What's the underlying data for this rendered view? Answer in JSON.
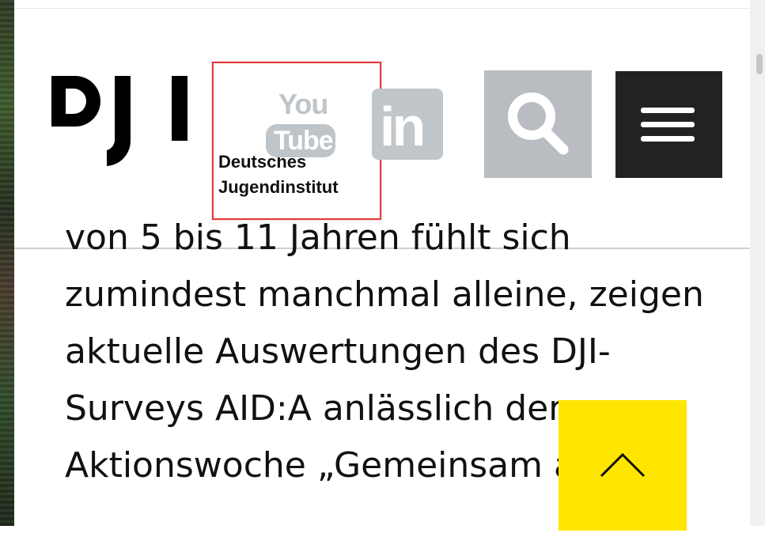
{
  "header": {
    "logo_alt": "DJI",
    "logo_text_line1": "Deutsches",
    "logo_text_line2": "Jugendinstitut",
    "youtube": {
      "top": "You",
      "bottom": "Tube"
    },
    "linkedin": "in",
    "icons": {
      "search": "search-icon",
      "menu": "hamburger-menu-icon",
      "youtube": "youtube-icon",
      "linkedin": "linkedin-icon"
    },
    "colors": {
      "highlight": "#e23a3a",
      "icon_gray": "#bfc4c8",
      "menu_bg": "#222222",
      "to_top_bg": "#ffe600"
    }
  },
  "article": {
    "lines": [
      "von 5 bis 11 Jahren fühlt sich",
      "zumindest manchmal alleine, zeigen",
      "aktuelle Auswertungen des DJI-",
      "Surveys AID:A anlässlich der",
      "Aktionswoche „Gemeinsam a"
    ]
  },
  "controls": {
    "to_top": "chevron-up-icon"
  }
}
